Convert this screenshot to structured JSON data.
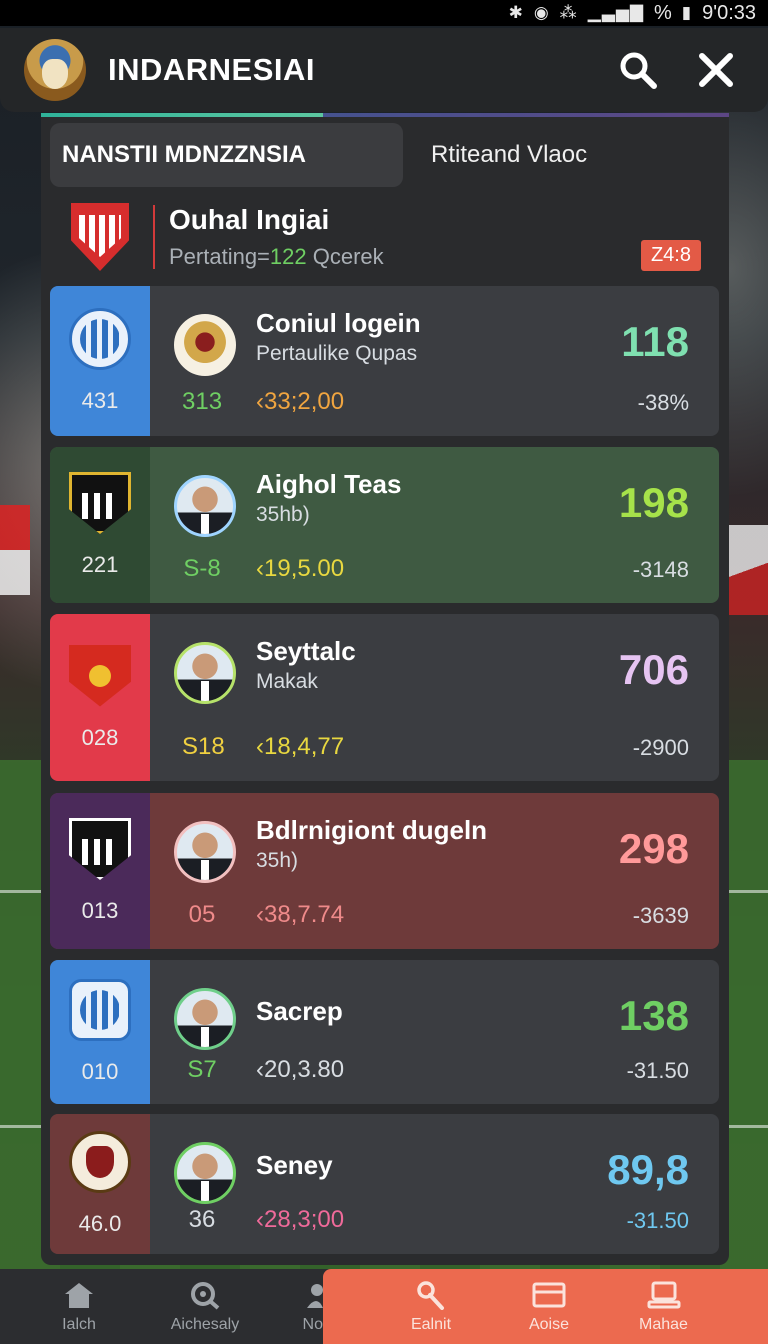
{
  "status_bar": {
    "icons": [
      "bluetooth-icon",
      "alarm-icon",
      "wifi-icon",
      "signal-icon"
    ],
    "battery": "%",
    "time": "9'0:33"
  },
  "header": {
    "title": "INDARNESIAI",
    "search_icon": "search-icon",
    "close_icon": "close-icon"
  },
  "progress": {
    "fraction": 0.41
  },
  "tabs": [
    {
      "label": "NANSTII MDNZZNSIA",
      "active": true
    },
    {
      "label": "Rtiteand Vlaoc",
      "active": false
    }
  ],
  "match": {
    "title": "Ouhal Ingiai",
    "subtitle_prefix": "Pertating=",
    "subtitle_value": "122",
    "subtitle_suffix": " Qcerek",
    "badge": "Z4:8"
  },
  "rows": [
    {
      "rank": "431",
      "name": "Coniul logein",
      "sub": "Pertaulike Qupas",
      "stat_a": "313",
      "stat_b": "33;2,00",
      "score": "118",
      "delta": "-38%",
      "colors": {
        "rank_bg": "#3f86d8",
        "row_bg": "#3b3d41",
        "stat_a": "#6fcf63",
        "stat_b": "#f0a540",
        "score": "#7fe0b0"
      }
    },
    {
      "rank": "221",
      "name": "Aighol Teas",
      "sub": "35hb)",
      "stat_a": "S-8",
      "stat_b": "19,5.00",
      "score": "198",
      "delta": "-3148",
      "colors": {
        "rank_bg": "#2f4a33",
        "row_bg": "#3f5a42",
        "stat_a": "#6fcf63",
        "stat_b": "#e8d840",
        "score": "#a6e24a"
      }
    },
    {
      "rank": "028",
      "name": "Seyttalc",
      "sub": "Makak",
      "stat_a": "S18",
      "stat_b": "18,4,77",
      "score": "706",
      "delta": "-2900",
      "colors": {
        "rank_bg": "#e23a4a",
        "row_bg": "#3b3d41",
        "stat_a": "#f0d040",
        "stat_b": "#e8d840",
        "score": "#e6c4f2"
      }
    },
    {
      "rank": "013",
      "name": "Bdlrnigiont dugeln",
      "sub": "35h)",
      "stat_a": "05",
      "stat_b": "38,7.74",
      "score": "298",
      "delta": "-3639",
      "colors": {
        "rank_bg": "#4b2a5a",
        "row_bg": "#6e3a3a",
        "stat_a": "#ef8a8a",
        "stat_b": "#ef8a8a",
        "score": "#ff9a9a"
      }
    },
    {
      "rank": "010",
      "name": "Sacrep",
      "sub": "",
      "stat_a": "S7",
      "stat_b": "20,3.80",
      "score": "138",
      "delta": "-31.50",
      "colors": {
        "rank_bg": "#3f86d8",
        "row_bg": "#3b3d41",
        "stat_a": "#6fcf63",
        "stat_b": "#d8dde2",
        "score": "#6fcf63"
      }
    },
    {
      "rank": "46.0",
      "name": "Seney",
      "sub": "",
      "stat_a": "36",
      "stat_b": "28,3;00",
      "score": "89,8",
      "delta": "-31.50",
      "colors": {
        "rank_bg": "#6e3a3a",
        "row_bg": "#3b3d41",
        "stat_a": "#d8dde2",
        "stat_b": "#ef6a9a",
        "score": "#6fc8f0"
      }
    }
  ],
  "nav": [
    {
      "label": "Ialch",
      "icon": "home-icon"
    },
    {
      "label": "Aichesaly",
      "icon": "search-target-icon"
    },
    {
      "label": "No",
      "icon": "user-icon"
    },
    {
      "label": "Ealnit",
      "icon": "tools-icon"
    },
    {
      "label": "Aoise",
      "icon": "wallet-icon"
    },
    {
      "label": "Mahae",
      "icon": "monitor-icon"
    }
  ]
}
